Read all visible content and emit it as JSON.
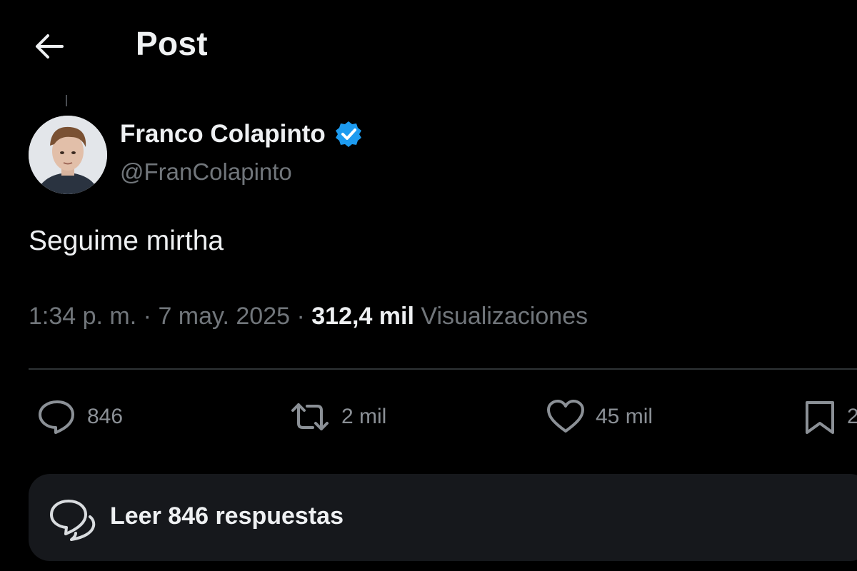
{
  "header": {
    "title": "Post",
    "back_icon": "arrow-left-icon"
  },
  "author": {
    "name": "Franco Colapinto",
    "handle": "@FranColapinto",
    "verified_icon": "verified-badge-icon",
    "verified_color": "#1d9bf0"
  },
  "post": {
    "text": "Seguime mirtha"
  },
  "meta": {
    "time": "1:34 p. m.",
    "separator": "·",
    "date": "7 may. 2025",
    "views_count": "312,4 mil",
    "views_label": "Visualizaciones"
  },
  "actions": {
    "replies": {
      "icon": "reply-icon",
      "count": "846"
    },
    "reposts": {
      "icon": "repost-icon",
      "count": "2 mil"
    },
    "likes": {
      "icon": "heart-icon",
      "count": "45 mil"
    },
    "bookmarks": {
      "icon": "bookmark-icon",
      "count": "2"
    }
  },
  "replies_bar": {
    "icon": "conversation-icon",
    "label": "Leer 846 respuestas"
  },
  "colors": {
    "background": "#000000",
    "text_primary": "#e7e9ea",
    "text_secondary": "#71767b",
    "divider": "#2f3336",
    "card": "#16181c"
  }
}
